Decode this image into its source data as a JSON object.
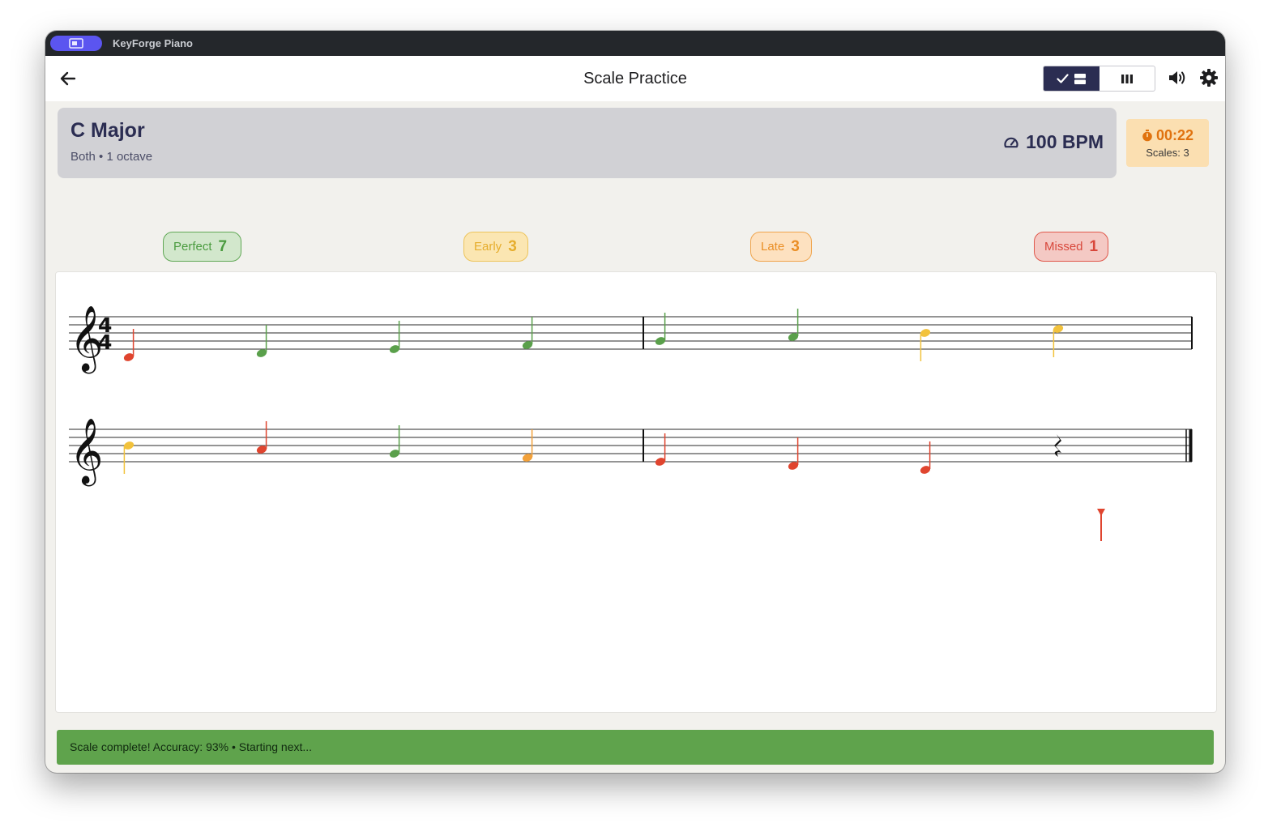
{
  "titlebar": {
    "app_name": "KeyForge Piano"
  },
  "header": {
    "title": "Scale Practice"
  },
  "scale": {
    "name": "C Major",
    "subtitle": "Both • 1 octave",
    "bpm": "100 BPM"
  },
  "timer": {
    "time": "00:22",
    "scales": "Scales: 3"
  },
  "stats": {
    "perfect": {
      "label": "Perfect",
      "count": "7"
    },
    "early": {
      "label": "Early",
      "count": "3"
    },
    "late": {
      "label": "Late",
      "count": "3"
    },
    "missed": {
      "label": "Missed",
      "count": "1"
    }
  },
  "score": {
    "time_signature": {
      "top": "4",
      "bottom": "4"
    },
    "colors": {
      "perfect": "#5aa04b",
      "early": "#f2c23c",
      "late": "#f2a13a",
      "missed": "#e0452f"
    },
    "systems": [
      {
        "clef": "treble",
        "show_time_signature": true,
        "notes": [
          {
            "pos": -6,
            "status": "missed",
            "stem": "up"
          },
          {
            "pos": -5,
            "status": "perfect",
            "stem": "up"
          },
          {
            "pos": -4,
            "status": "perfect",
            "stem": "up"
          },
          {
            "pos": -3,
            "status": "perfect",
            "stem": "up"
          },
          {
            "pos": -2,
            "status": "perfect",
            "stem": "up"
          },
          {
            "pos": -1,
            "status": "perfect",
            "stem": "up"
          },
          {
            "pos": 0,
            "status": "early",
            "stem": "down"
          },
          {
            "pos": 1,
            "status": "early",
            "stem": "down"
          }
        ]
      },
      {
        "clef": "treble",
        "show_time_signature": false,
        "notes": [
          {
            "pos": 0,
            "status": "early",
            "stem": "down"
          },
          {
            "pos": -1,
            "status": "missed",
            "stem": "up"
          },
          {
            "pos": -2,
            "status": "perfect",
            "stem": "up"
          },
          {
            "pos": -3,
            "status": "late",
            "stem": "up"
          },
          {
            "pos": -4,
            "status": "missed",
            "stem": "up"
          },
          {
            "pos": -5,
            "status": "missed",
            "stem": "up"
          },
          {
            "pos": -6,
            "status": "missed",
            "stem": "up"
          },
          {
            "rest": true
          }
        ]
      }
    ]
  },
  "status": {
    "message": "Scale complete! Accuracy: 93% • Starting next..."
  }
}
